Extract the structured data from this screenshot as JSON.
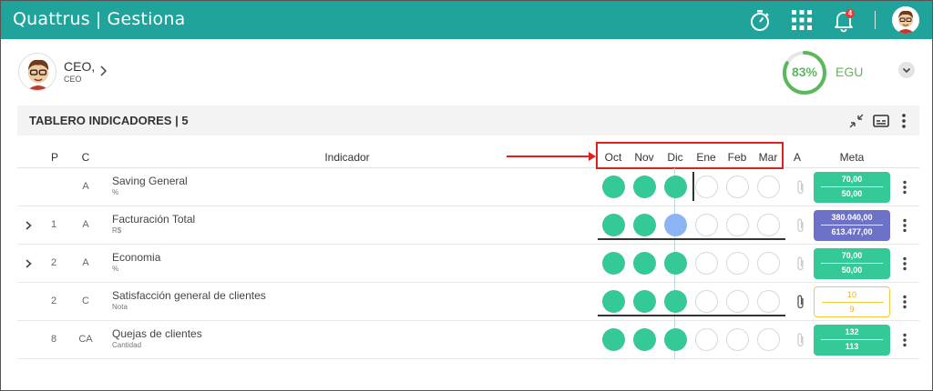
{
  "app": {
    "brand": "Quattrus",
    "module": "Gestiona",
    "notification_count": "4"
  },
  "profile": {
    "name": "CEO,",
    "role": "CEO"
  },
  "score": {
    "value": "83%",
    "percent": 83,
    "label": "EGU"
  },
  "panel": {
    "title": "TABLERO INDICADORES | 5"
  },
  "columns": {
    "p": "P",
    "c": "C",
    "indicator": "Indicador",
    "months": [
      "Oct",
      "Nov",
      "Dic",
      "Ene",
      "Feb",
      "Mar"
    ],
    "a": "A",
    "meta": "Meta"
  },
  "rows": [
    {
      "expandable": false,
      "p": "",
      "c": "A",
      "name": "Saving General",
      "unit": "%",
      "months": [
        "green",
        "green",
        "green",
        "empty",
        "empty",
        "empty"
      ],
      "meta_top": "70,00",
      "meta_bottom": "50,00",
      "meta_style": "green",
      "attachment": false
    },
    {
      "expandable": true,
      "p": "1",
      "c": "A",
      "name": "Facturación Total",
      "unit": "R$",
      "months": [
        "green",
        "green",
        "blue",
        "empty",
        "empty",
        "empty"
      ],
      "meta_top": "380.040,00",
      "meta_bottom": "613.477,00",
      "meta_style": "purple",
      "attachment": false
    },
    {
      "expandable": true,
      "p": "2",
      "c": "A",
      "name": "Economia",
      "unit": "%",
      "months": [
        "green",
        "green",
        "green",
        "empty",
        "empty",
        "empty"
      ],
      "meta_top": "70,00",
      "meta_bottom": "50,00",
      "meta_style": "green",
      "attachment": false
    },
    {
      "expandable": false,
      "p": "2",
      "c": "C",
      "name": "Satisfacción general de clientes",
      "unit": "Nota",
      "months": [
        "green",
        "green",
        "green",
        "empty",
        "empty",
        "empty"
      ],
      "meta_top": "10",
      "meta_bottom": "9",
      "meta_style": "outline",
      "attachment": true
    },
    {
      "expandable": false,
      "p": "8",
      "c": "CA",
      "name": "Quejas de clientes",
      "unit": "Cantidad",
      "months": [
        "green",
        "green",
        "green",
        "empty",
        "empty",
        "empty"
      ],
      "meta_top": "132",
      "meta_bottom": "113",
      "meta_style": "green",
      "attachment": false
    }
  ],
  "colors": {
    "topbar": "#1fa39b",
    "dot_green": "#34c997",
    "dot_blue": "#8cb4f5",
    "meta_purple": "#6d72c8",
    "highlight": "#e02020"
  }
}
